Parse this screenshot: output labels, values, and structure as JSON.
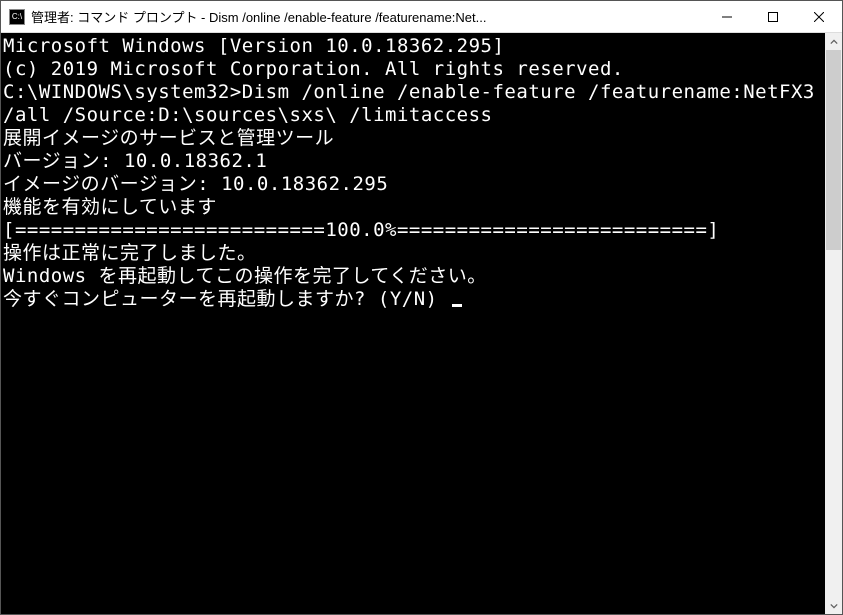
{
  "titlebar": {
    "icon_label": "C:\\",
    "title": "管理者: コマンド プロンプト - Dism  /online /enable-feature /featurename:Net..."
  },
  "terminal": {
    "lines": [
      "Microsoft Windows [Version 10.0.18362.295]",
      "(c) 2019 Microsoft Corporation. All rights reserved.",
      "",
      "C:\\WINDOWS\\system32>Dism /online /enable-feature /featurename:NetFX3 /all /Source:D:\\sources\\sxs\\ /limitaccess",
      "",
      "展開イメージのサービスと管理ツール",
      "バージョン: 10.0.18362.1",
      "",
      "イメージのバージョン: 10.0.18362.295",
      "",
      "機能を有効にしています",
      "[==========================100.0%==========================]",
      "操作は正常に完了しました。",
      "Windows を再起動してこの操作を完了してください。",
      "今すぐコンピューターを再起動しますか? (Y/N) "
    ]
  }
}
